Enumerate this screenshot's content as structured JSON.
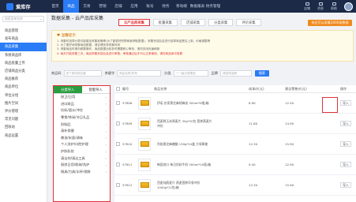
{
  "app": {
    "logo_text": "爱库存"
  },
  "topnav": [
    "首页",
    "商品",
    "交易",
    "营销",
    "店铺",
    "应用",
    "账号",
    "财务",
    "移动端",
    "数据报表",
    "财务管理"
  ],
  "topnav_active": 1,
  "right_menu": [
    "店铺",
    "消息",
    "帮助"
  ],
  "sidebar": {
    "search_placeholder": "搜索菜单名称",
    "items": [
      "商品管理",
      "发布商品",
      "商品采集",
      "系统商品库",
      "商品批量上传",
      "店铺商品分类",
      "商品推荐",
      "商品单位",
      "单位分组",
      "图片空间",
      "评价管理",
      "常见问题",
      "回收站",
      "商品设置"
    ],
    "active_index": 2
  },
  "page": {
    "title": "数据采集 - 云产品库采集",
    "tabs": [
      "云产品库采集",
      "批量采集",
      "店铺采集",
      "分类采集",
      "评论采集"
    ],
    "active_tab": 0,
    "right_button": "你还可以采集1000条数据"
  },
  "tips": {
    "title": "温馨提示",
    "lines": [
      "1. 采集时选择分类可能增加采集准确率(为了能更好的帮商家获取数据)，采集完成后会进行选择商品是否上架、价格调整等",
      "2. 为了更好地采集商品数据，请合理安排采集时间",
      "3. 采集商品时请勿频繁操作，商品数据比较多时需要耐心等待，请勿关闭页面刷新"
    ],
    "warning": "4. 每天只能采集三次，商品采集完成后会进行审核，审核通过后才可以正常使用，请在商品库中查看"
  },
  "filter": {
    "label_no": "商品码",
    "placeholder_no": "多个条码用空格",
    "label_keyword": "关键字",
    "placeholder_keyword": "商品名称/货号",
    "label_category": "分类",
    "placeholder_category": "一一级分类筛选",
    "label_brand": "品牌",
    "placeholder_brand": "请选择品牌",
    "search_button": "搜索"
  },
  "category_tabs": [
    "分类导入",
    "智能导入"
  ],
  "category_active": 0,
  "categories": [
    "厨卫/日用",
    "进口商品",
    "饮料/酒水/冲饮",
    "零食/休闲/节日礼品",
    "奶制品",
    "清补保健",
    "粮油/米面/调味",
    "个人洗护/口腔护理",
    "护肤彩妆",
    "清洁剂/清洁工具",
    "厨房日用/收纳/洗护",
    "锅具/刀具/水杯/保鲜"
  ],
  "table": {
    "headers": [
      "编号",
      "商品名称",
      "成本价(元)",
      "建议零售价(元)",
      "操作"
    ],
    "rows": [
      {
        "id": "57806",
        "name": "伊诺 农家黑芝麻胡麻油 300ml*8瓶/箱",
        "cost": "8.90",
        "retail": "12.50",
        "action": "导入"
      },
      {
        "id": "57809",
        "name": "西麦鲜玉米原麦片 30g*20包 营养燕麦片冲饮",
        "cost": "11.80",
        "retail": "14.90",
        "action": "导入"
      },
      {
        "id": "57810",
        "name": "利焰黑芝麻糖醋 150g*24盒 大塚胃能",
        "cost": "12.30",
        "retail": "15.90",
        "action": "导入"
      },
      {
        "id": "57811",
        "name": "韩国进口 每日饮料牛奶 500ml*20瓶/箱",
        "cost": "9.50",
        "retail": "12.90",
        "action": "导入"
      },
      {
        "id": "57812",
        "name": "西麦纯燕麦片 燕麦营养早餐冲饮 1000g*12包/箱",
        "cost": "12.30",
        "retail": "15.90",
        "action": "导入"
      }
    ]
  },
  "colors": {
    "topbar": "#1c2a48",
    "accent": "#2a7bf6",
    "highlight": "#e0333a",
    "green_tab": "#2a9d3f",
    "orange": "#f08a1c"
  }
}
